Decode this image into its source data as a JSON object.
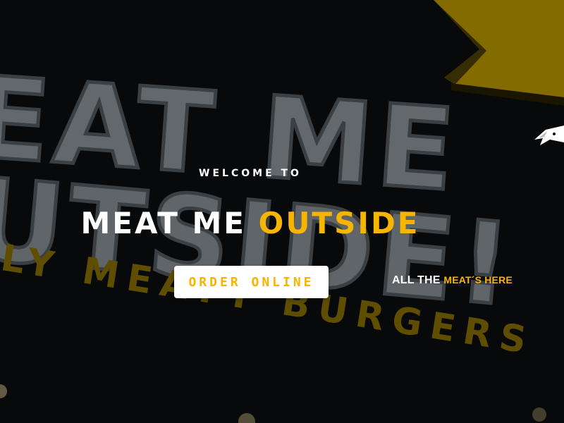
{
  "hero": {
    "background_sign": {
      "line1": "EAT ME",
      "line2": "UTSIDE!",
      "line3": "LY MEATY BURGERS"
    },
    "welcome": "Welcome to",
    "title_white": "Meat Me",
    "title_yellow": "Outside",
    "order_button": "Order online",
    "tagline_white": "ALL THE",
    "tagline_yellow": "MEAT´S HERE"
  },
  "colors": {
    "accent_yellow": "#f7b500",
    "background": "#0b0b0b",
    "text_white": "#ffffff"
  },
  "icons": {
    "side_logo": "bird-logo-icon"
  }
}
